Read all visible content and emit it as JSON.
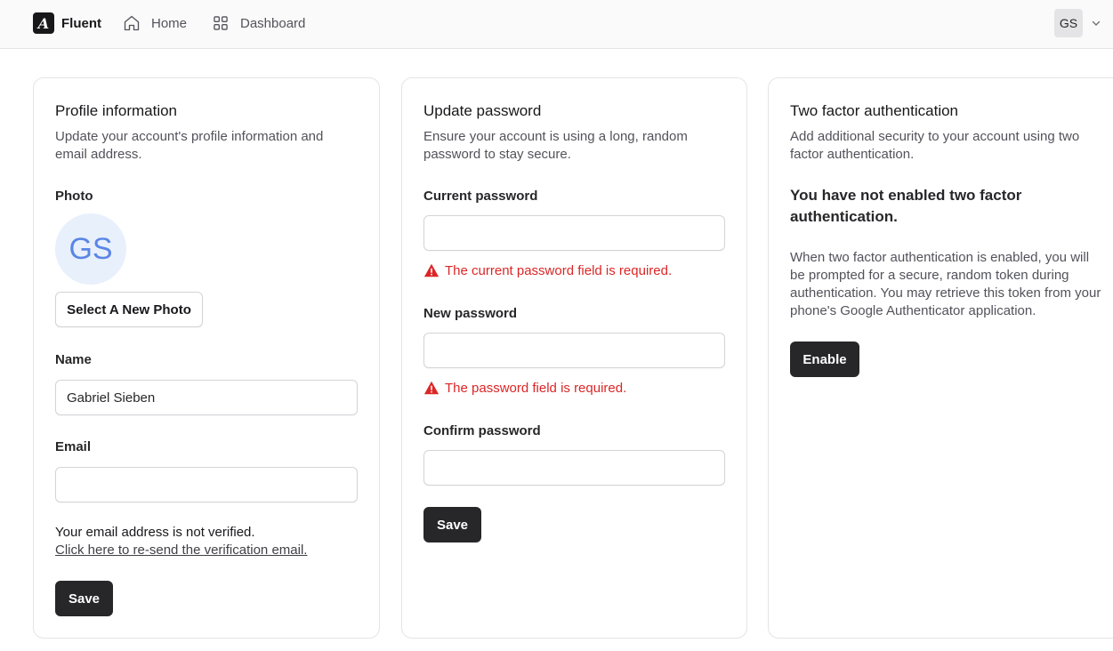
{
  "nav": {
    "brand_mark": "A",
    "brand_name": "Fluent",
    "home_label": "Home",
    "dashboard_label": "Dashboard",
    "user_initials": "GS",
    "home_icon": "home-icon",
    "dashboard_icon": "grid-icon",
    "chevron_icon": "chevron-down-icon"
  },
  "profile": {
    "title": "Profile information",
    "description": "Update your account's profile information and email address.",
    "photo_label": "Photo",
    "photo_initials": "GS",
    "select_photo_label": "Select A New Photo",
    "name_label": "Name",
    "name_value": "Gabriel Sieben",
    "email_label": "Email",
    "email_value": "",
    "unverified_text": "Your email address is not verified.",
    "resend_link": "Click here to re-send the verification email.",
    "save_label": "Save"
  },
  "password": {
    "title": "Update password",
    "description": "Ensure your account is using a long, random password to stay secure.",
    "current_label": "Current password",
    "current_error": "The current password field is required.",
    "new_label": "New password",
    "new_error": "The password field is required.",
    "confirm_label": "Confirm password",
    "save_label": "Save"
  },
  "two_factor": {
    "title": "Two factor authentication",
    "description": "Add additional security to your account using two factor authentication.",
    "status_heading": "You have not enabled two factor authentication.",
    "info_text": "When two factor authentication is enabled, you will be prompted for a secure, random token during authentication. You may retrieve this token from your phone's Google Authenticator application.",
    "enable_label": "Enable"
  },
  "colors": {
    "accent_dark": "#27272a",
    "error_red": "#dc2626",
    "avatar_blue": "#5b86e5",
    "avatar_bg": "#e8f0fc"
  }
}
